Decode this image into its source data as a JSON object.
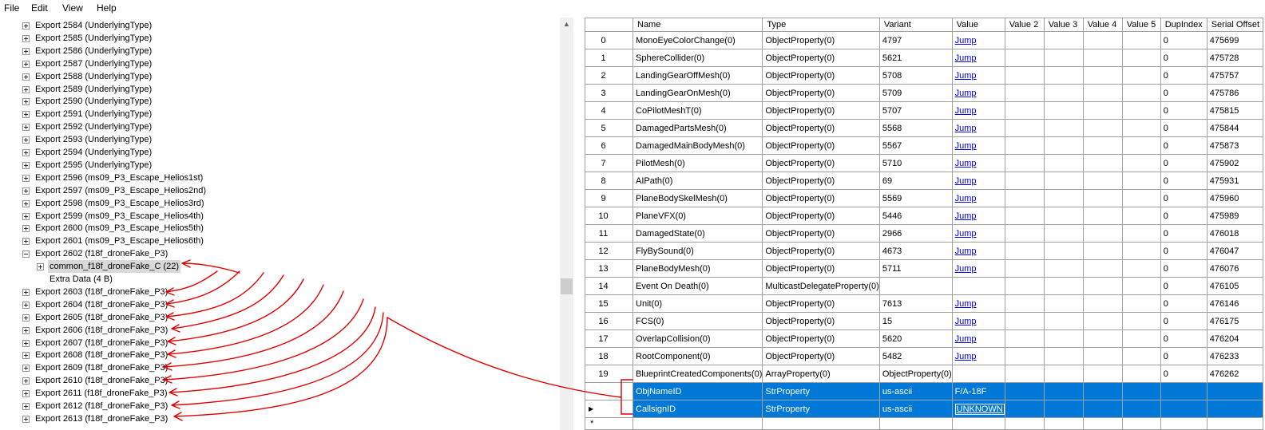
{
  "menu": [
    "File",
    "Edit",
    "View",
    "Help"
  ],
  "tree": {
    "items": [
      {
        "label": "Export 2584 (UnderlyingType)",
        "indent": 0,
        "toggle": "plus"
      },
      {
        "label": "Export 2585 (UnderlyingType)",
        "indent": 0,
        "toggle": "plus"
      },
      {
        "label": "Export 2586 (UnderlyingType)",
        "indent": 0,
        "toggle": "plus"
      },
      {
        "label": "Export 2587 (UnderlyingType)",
        "indent": 0,
        "toggle": "plus"
      },
      {
        "label": "Export 2588 (UnderlyingType)",
        "indent": 0,
        "toggle": "plus"
      },
      {
        "label": "Export 2589 (UnderlyingType)",
        "indent": 0,
        "toggle": "plus"
      },
      {
        "label": "Export 2590 (UnderlyingType)",
        "indent": 0,
        "toggle": "plus"
      },
      {
        "label": "Export 2591 (UnderlyingType)",
        "indent": 0,
        "toggle": "plus"
      },
      {
        "label": "Export 2592 (UnderlyingType)",
        "indent": 0,
        "toggle": "plus"
      },
      {
        "label": "Export 2593 (UnderlyingType)",
        "indent": 0,
        "toggle": "plus"
      },
      {
        "label": "Export 2594 (UnderlyingType)",
        "indent": 0,
        "toggle": "plus"
      },
      {
        "label": "Export 2595 (UnderlyingType)",
        "indent": 0,
        "toggle": "plus"
      },
      {
        "label": "Export 2596 (ms09_P3_Escape_Helios1st)",
        "indent": 0,
        "toggle": "plus"
      },
      {
        "label": "Export 2597 (ms09_P3_Escape_Helios2nd)",
        "indent": 0,
        "toggle": "plus"
      },
      {
        "label": "Export 2598 (ms09_P3_Escape_Helios3rd)",
        "indent": 0,
        "toggle": "plus"
      },
      {
        "label": "Export 2599 (ms09_P3_Escape_Helios4th)",
        "indent": 0,
        "toggle": "plus"
      },
      {
        "label": "Export 2600 (ms09_P3_Escape_Helios5th)",
        "indent": 0,
        "toggle": "plus"
      },
      {
        "label": "Export 2601 (ms09_P3_Escape_Helios6th)",
        "indent": 0,
        "toggle": "plus"
      },
      {
        "label": "Export 2602 (f18f_droneFake_P3)",
        "indent": 0,
        "toggle": "minus"
      },
      {
        "label": "common_f18f_droneFake_C (22)",
        "indent": 1,
        "toggle": "plus",
        "selected": true
      },
      {
        "label": "Extra Data (4 B)",
        "indent": 1,
        "toggle": "none"
      },
      {
        "label": "Export 2603 (f18f_droneFake_P3)",
        "indent": 0,
        "toggle": "plus"
      },
      {
        "label": "Export 2604 (f18f_droneFake_P3)",
        "indent": 0,
        "toggle": "plus"
      },
      {
        "label": "Export 2605 (f18f_droneFake_P3)",
        "indent": 0,
        "toggle": "plus"
      },
      {
        "label": "Export 2606 (f18f_droneFake_P3)",
        "indent": 0,
        "toggle": "plus"
      },
      {
        "label": "Export 2607 (f18f_droneFake_P3)",
        "indent": 0,
        "toggle": "plus"
      },
      {
        "label": "Export 2608 (f18f_droneFake_P3)",
        "indent": 0,
        "toggle": "plus"
      },
      {
        "label": "Export 2609 (f18f_droneFake_P3)",
        "indent": 0,
        "toggle": "plus"
      },
      {
        "label": "Export 2610 (f18f_droneFake_P3)",
        "indent": 0,
        "toggle": "plus"
      },
      {
        "label": "Export 2611 (f18f_droneFake_P3)",
        "indent": 0,
        "toggle": "plus"
      },
      {
        "label": "Export 2612 (f18f_droneFake_P3)",
        "indent": 0,
        "toggle": "plus"
      },
      {
        "label": "Export 2613 (f18f_droneFake_P3)",
        "indent": 0,
        "toggle": "plus"
      }
    ]
  },
  "grid": {
    "columns": [
      "",
      "Name",
      "Type",
      "Variant",
      "Value",
      "Value 2",
      "Value 3",
      "Value 4",
      "Value 5",
      "DupIndex",
      "Serial Offset"
    ],
    "rows": [
      {
        "index": "0",
        "name": "MonoEyeColorChange(0)",
        "type": "ObjectProperty(0)",
        "variant": "4797",
        "value": "Jump",
        "dup": "0",
        "offset": "475699"
      },
      {
        "index": "1",
        "name": "SphereCollider(0)",
        "type": "ObjectProperty(0)",
        "variant": "5621",
        "value": "Jump",
        "dup": "0",
        "offset": "475728"
      },
      {
        "index": "2",
        "name": "LandingGearOffMesh(0)",
        "type": "ObjectProperty(0)",
        "variant": "5708",
        "value": "Jump",
        "dup": "0",
        "offset": "475757"
      },
      {
        "index": "3",
        "name": "LandingGearOnMesh(0)",
        "type": "ObjectProperty(0)",
        "variant": "5709",
        "value": "Jump",
        "dup": "0",
        "offset": "475786"
      },
      {
        "index": "4",
        "name": "CoPilotMeshT(0)",
        "type": "ObjectProperty(0)",
        "variant": "5707",
        "value": "Jump",
        "dup": "0",
        "offset": "475815"
      },
      {
        "index": "5",
        "name": "DamagedPartsMesh(0)",
        "type": "ObjectProperty(0)",
        "variant": "5568",
        "value": "Jump",
        "dup": "0",
        "offset": "475844"
      },
      {
        "index": "6",
        "name": "DamagedMainBodyMesh(0)",
        "type": "ObjectProperty(0)",
        "variant": "5567",
        "value": "Jump",
        "dup": "0",
        "offset": "475873"
      },
      {
        "index": "7",
        "name": "PilotMesh(0)",
        "type": "ObjectProperty(0)",
        "variant": "5710",
        "value": "Jump",
        "dup": "0",
        "offset": "475902"
      },
      {
        "index": "8",
        "name": "AIPath(0)",
        "type": "ObjectProperty(0)",
        "variant": "69",
        "value": "Jump",
        "dup": "0",
        "offset": "475931"
      },
      {
        "index": "9",
        "name": "PlaneBodySkelMesh(0)",
        "type": "ObjectProperty(0)",
        "variant": "5569",
        "value": "Jump",
        "dup": "0",
        "offset": "475960"
      },
      {
        "index": "10",
        "name": "PlaneVFX(0)",
        "type": "ObjectProperty(0)",
        "variant": "5446",
        "value": "Jump",
        "dup": "0",
        "offset": "475989"
      },
      {
        "index": "11",
        "name": "DamagedState(0)",
        "type": "ObjectProperty(0)",
        "variant": "2966",
        "value": "Jump",
        "dup": "0",
        "offset": "476018"
      },
      {
        "index": "12",
        "name": "FlyBySound(0)",
        "type": "ObjectProperty(0)",
        "variant": "4673",
        "value": "Jump",
        "dup": "0",
        "offset": "476047"
      },
      {
        "index": "13",
        "name": "PlaneBodyMesh(0)",
        "type": "ObjectProperty(0)",
        "variant": "5711",
        "value": "Jump",
        "dup": "0",
        "offset": "476076"
      },
      {
        "index": "14",
        "name": "Event On Death(0)",
        "type": "MulticastDelegateProperty(0)",
        "variant": "",
        "value": "",
        "dup": "0",
        "offset": "476105"
      },
      {
        "index": "15",
        "name": "Unit(0)",
        "type": "ObjectProperty(0)",
        "variant": "7613",
        "value": "Jump",
        "dup": "0",
        "offset": "476146"
      },
      {
        "index": "16",
        "name": "FCS(0)",
        "type": "ObjectProperty(0)",
        "variant": "15",
        "value": "Jump",
        "dup": "0",
        "offset": "476175"
      },
      {
        "index": "17",
        "name": "OverlapCollision(0)",
        "type": "ObjectProperty(0)",
        "variant": "5620",
        "value": "Jump",
        "dup": "0",
        "offset": "476204"
      },
      {
        "index": "18",
        "name": "RootComponent(0)",
        "type": "ObjectProperty(0)",
        "variant": "5482",
        "value": "Jump",
        "dup": "0",
        "offset": "476233"
      },
      {
        "index": "19",
        "name": "BlueprintCreatedComponents(0)",
        "type": "ArrayProperty(0)",
        "variant": "ObjectProperty(0)",
        "value": "",
        "dup": "0",
        "offset": "476262"
      },
      {
        "index": "",
        "name": "ObjNameID",
        "type": "StrProperty",
        "variant": "us-ascii",
        "value": "F/A-18F",
        "dup": "",
        "offset": "",
        "selected": true
      },
      {
        "index": "",
        "name": "CallsignID",
        "type": "StrProperty",
        "variant": "us-ascii",
        "value": "UNKNOWN",
        "dup": "",
        "offset": "",
        "selected": true,
        "current": true,
        "editing": true
      }
    ],
    "new_row_marker": "*"
  },
  "colors": {
    "selection": "#0078d7",
    "link": "#0000ee",
    "annotation": "#e00000"
  }
}
